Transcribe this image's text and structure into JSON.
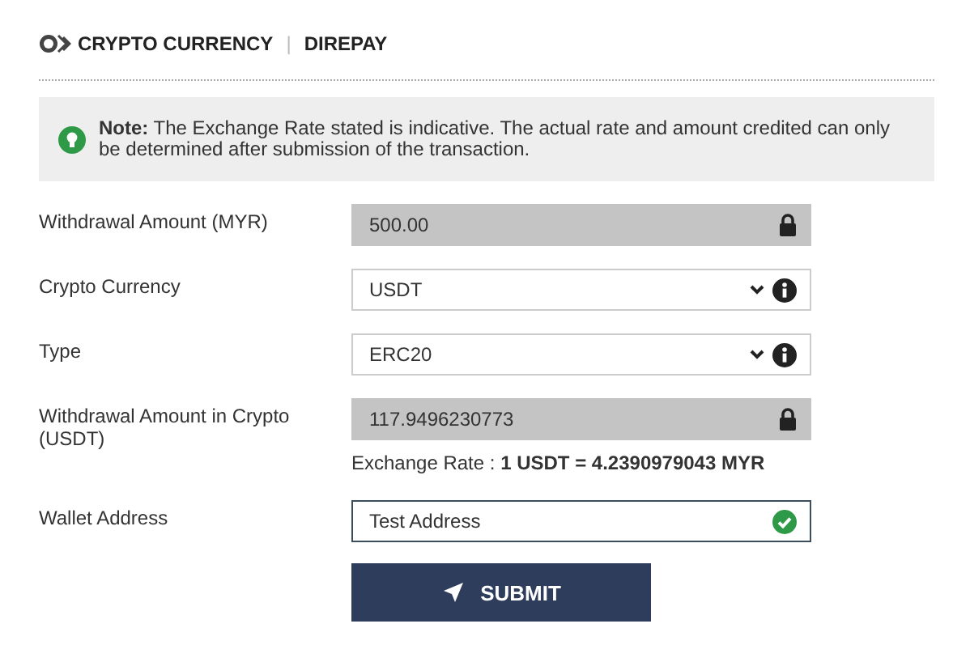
{
  "header": {
    "title": "CRYPTO CURRENCY",
    "separator": "|",
    "provider": "DIREPAY"
  },
  "note": "**Note:** The Exchange Rate stated is indicative. The actual rate and amount credited can only be determined after submission of the transaction.",
  "fields": [
    {
      "label": "Withdrawal Amount (MYR)",
      "kind": "locked",
      "value": "500.00"
    },
    {
      "label": "Crypto Currency",
      "kind": "select",
      "value": "USDT"
    },
    {
      "label": "Type",
      "kind": "select",
      "value": "ERC20"
    },
    {
      "label": "Withdrawal Amount in Crypto (USDT)",
      "kind": "locked",
      "value": "117.9496230773",
      "hint_label": "Exchange Rate : ",
      "hint_value": "1 USDT = 4.2390979043 MYR"
    },
    {
      "label": "Wallet Address",
      "kind": "text",
      "value": "Test Address",
      "valid": true
    }
  ],
  "submit": "SUBMIT"
}
